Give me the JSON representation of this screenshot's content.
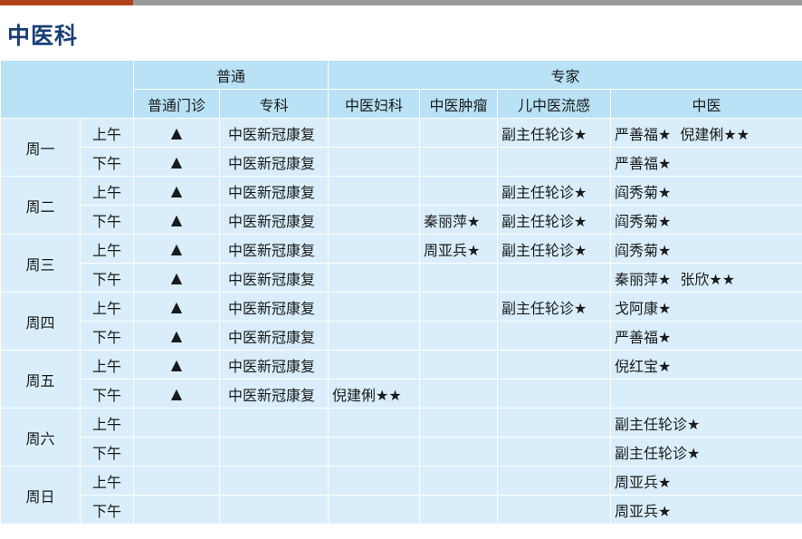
{
  "page": {
    "title": "中医科"
  },
  "colors": {
    "accent": "#b0421b",
    "title": "#1b3f75",
    "header_bg": "#b9e2f6",
    "cell_bg": "#d9eefa"
  },
  "header": {
    "group_general": "普通",
    "group_expert": "专家",
    "cols": [
      "普通门诊",
      "专科",
      "中医妇科",
      "中医肿瘤",
      "儿中医流感",
      "中医"
    ]
  },
  "days": [
    {
      "day": "周一",
      "rows": [
        {
          "period": "上午",
          "general": "▲",
          "specialty": "中医新冠康复",
          "gyn": "",
          "onco": "",
          "peds": "副主任轮诊★",
          "tcm": [
            "严善福★",
            "倪建俐★★"
          ]
        },
        {
          "period": "下午",
          "general": "▲",
          "specialty": "中医新冠康复",
          "gyn": "",
          "onco": "",
          "peds": "",
          "tcm": [
            "严善福★"
          ]
        }
      ]
    },
    {
      "day": "周二",
      "rows": [
        {
          "period": "上午",
          "general": "▲",
          "specialty": "中医新冠康复",
          "gyn": "",
          "onco": "",
          "peds": "副主任轮诊★",
          "tcm": [
            "阎秀菊★"
          ]
        },
        {
          "period": "下午",
          "general": "▲",
          "specialty": "中医新冠康复",
          "gyn": "",
          "onco": "秦丽萍★",
          "peds": "副主任轮诊★",
          "tcm": [
            "阎秀菊★"
          ]
        }
      ]
    },
    {
      "day": "周三",
      "rows": [
        {
          "period": "上午",
          "general": "▲",
          "specialty": "中医新冠康复",
          "gyn": "",
          "onco": "周亚兵★",
          "peds": "副主任轮诊★",
          "tcm": [
            "阎秀菊★"
          ]
        },
        {
          "period": "下午",
          "general": "▲",
          "specialty": "中医新冠康复",
          "gyn": "",
          "onco": "",
          "peds": "",
          "tcm": [
            "秦丽萍★",
            "张欣★★"
          ]
        }
      ]
    },
    {
      "day": "周四",
      "rows": [
        {
          "period": "上午",
          "general": "▲",
          "specialty": "中医新冠康复",
          "gyn": "",
          "onco": "",
          "peds": "副主任轮诊★",
          "tcm": [
            "戈阿康★"
          ]
        },
        {
          "period": "下午",
          "general": "▲",
          "specialty": "中医新冠康复",
          "gyn": "",
          "onco": "",
          "peds": "",
          "tcm": [
            "严善福★"
          ]
        }
      ]
    },
    {
      "day": "周五",
      "rows": [
        {
          "period": "上午",
          "general": "▲",
          "specialty": "中医新冠康复",
          "gyn": "",
          "onco": "",
          "peds": "",
          "tcm": [
            "倪红宝★"
          ]
        },
        {
          "period": "下午",
          "general": "▲",
          "specialty": "中医新冠康复",
          "gyn": "倪建俐★★",
          "onco": "",
          "peds": "",
          "tcm": []
        }
      ]
    },
    {
      "day": "周六",
      "rows": [
        {
          "period": "上午",
          "general": "",
          "specialty": "",
          "gyn": "",
          "onco": "",
          "peds": "",
          "tcm": [
            "副主任轮诊★"
          ]
        },
        {
          "period": "下午",
          "general": "",
          "specialty": "",
          "gyn": "",
          "onco": "",
          "peds": "",
          "tcm": [
            "副主任轮诊★"
          ]
        }
      ]
    },
    {
      "day": "周日",
      "rows": [
        {
          "period": "上午",
          "general": "",
          "specialty": "",
          "gyn": "",
          "onco": "",
          "peds": "",
          "tcm": [
            "周亚兵★"
          ]
        },
        {
          "period": "下午",
          "general": "",
          "specialty": "",
          "gyn": "",
          "onco": "",
          "peds": "",
          "tcm": [
            "周亚兵★"
          ]
        }
      ]
    }
  ]
}
